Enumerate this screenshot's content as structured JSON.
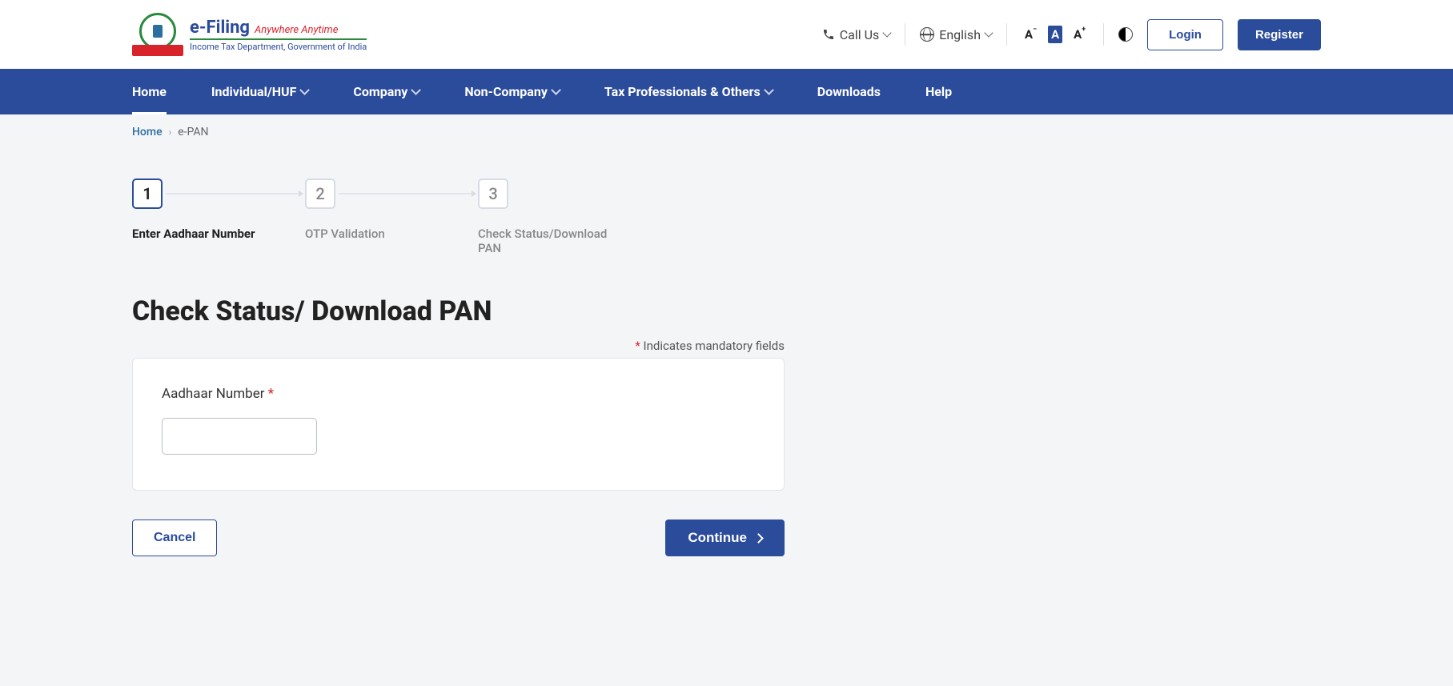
{
  "header": {
    "logo_main": "e-Filing",
    "logo_tagline": "Anywhere Anytime",
    "logo_sub": "Income Tax Department, Government of India",
    "call_us": "Call Us",
    "language": "English",
    "login": "Login",
    "register": "Register",
    "font_minus": "A",
    "font_normal": "A",
    "font_plus": "A"
  },
  "nav": {
    "home": "Home",
    "individual": "Individual/HUF",
    "company": "Company",
    "noncompany": "Non-Company",
    "taxpro": "Tax Professionals & Others",
    "downloads": "Downloads",
    "help": "Help"
  },
  "breadcrumb": {
    "home": "Home",
    "current": "e-PAN"
  },
  "steps": {
    "s1_num": "1",
    "s1_label": "Enter Aadhaar Number",
    "s2_num": "2",
    "s2_label": "OTP Validation",
    "s3_num": "3",
    "s3_label": "Check Status/Download PAN"
  },
  "page": {
    "title": "Check Status/ Download PAN",
    "mandatory_prefix": "*",
    "mandatory_text": " Indicates mandatory fields",
    "aadhaar_label": "Aadhaar Number ",
    "aadhaar_ast": "*",
    "cancel": "Cancel",
    "continue": "Continue"
  }
}
